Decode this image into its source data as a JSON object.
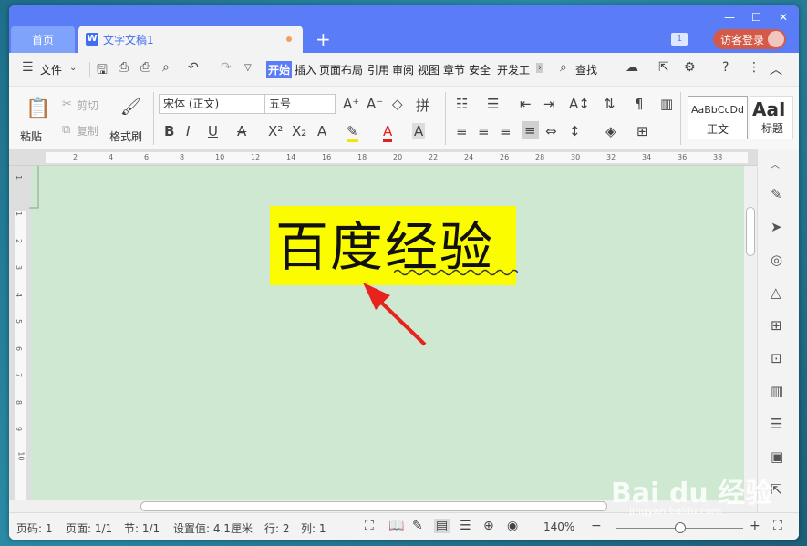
{
  "titlebar": {
    "home_tab": "首页",
    "doc_tab": "文字文稿1",
    "add_tab": "+",
    "notification_count": "1",
    "login_label": "访客登录"
  },
  "menubar": {
    "file": "文件",
    "tabs": [
      "开始",
      "插入",
      "页面布局",
      "引用",
      "审阅",
      "视图",
      "章节",
      "安全",
      "开发工"
    ],
    "active_tab": "开始",
    "find": "查找"
  },
  "ribbon": {
    "paste": "粘贴",
    "cut": "剪切",
    "copy": "复制",
    "format_painter": "格式刷",
    "font_name": "宋体 (正文)",
    "font_size": "五号",
    "style_normal_preview": "AaBbCcDd",
    "style_normal_label": "正文",
    "style_heading_preview": "AaI",
    "style_heading_label": "标题"
  },
  "ruler": {
    "top_numbers": [
      "2",
      "4",
      "6",
      "8",
      "10",
      "12",
      "14",
      "16",
      "18",
      "20",
      "22",
      "24",
      "26",
      "28",
      "30",
      "32",
      "34",
      "36",
      "38"
    ],
    "left_numbers": [
      "1",
      "1",
      "2",
      "3",
      "4",
      "5",
      "6",
      "7",
      "8",
      "9",
      "10"
    ]
  },
  "document": {
    "text": "百度经验"
  },
  "statusbar": {
    "page_code": "页码: 1",
    "page": "页面: 1/1",
    "section": "节: 1/1",
    "setting": "设置值: 4.1厘米",
    "line": "行: 2",
    "column": "列: 1",
    "zoom": "140%"
  },
  "watermark": {
    "brand": "Bai du 经验",
    "url": "jingyan.baidu.com"
  }
}
